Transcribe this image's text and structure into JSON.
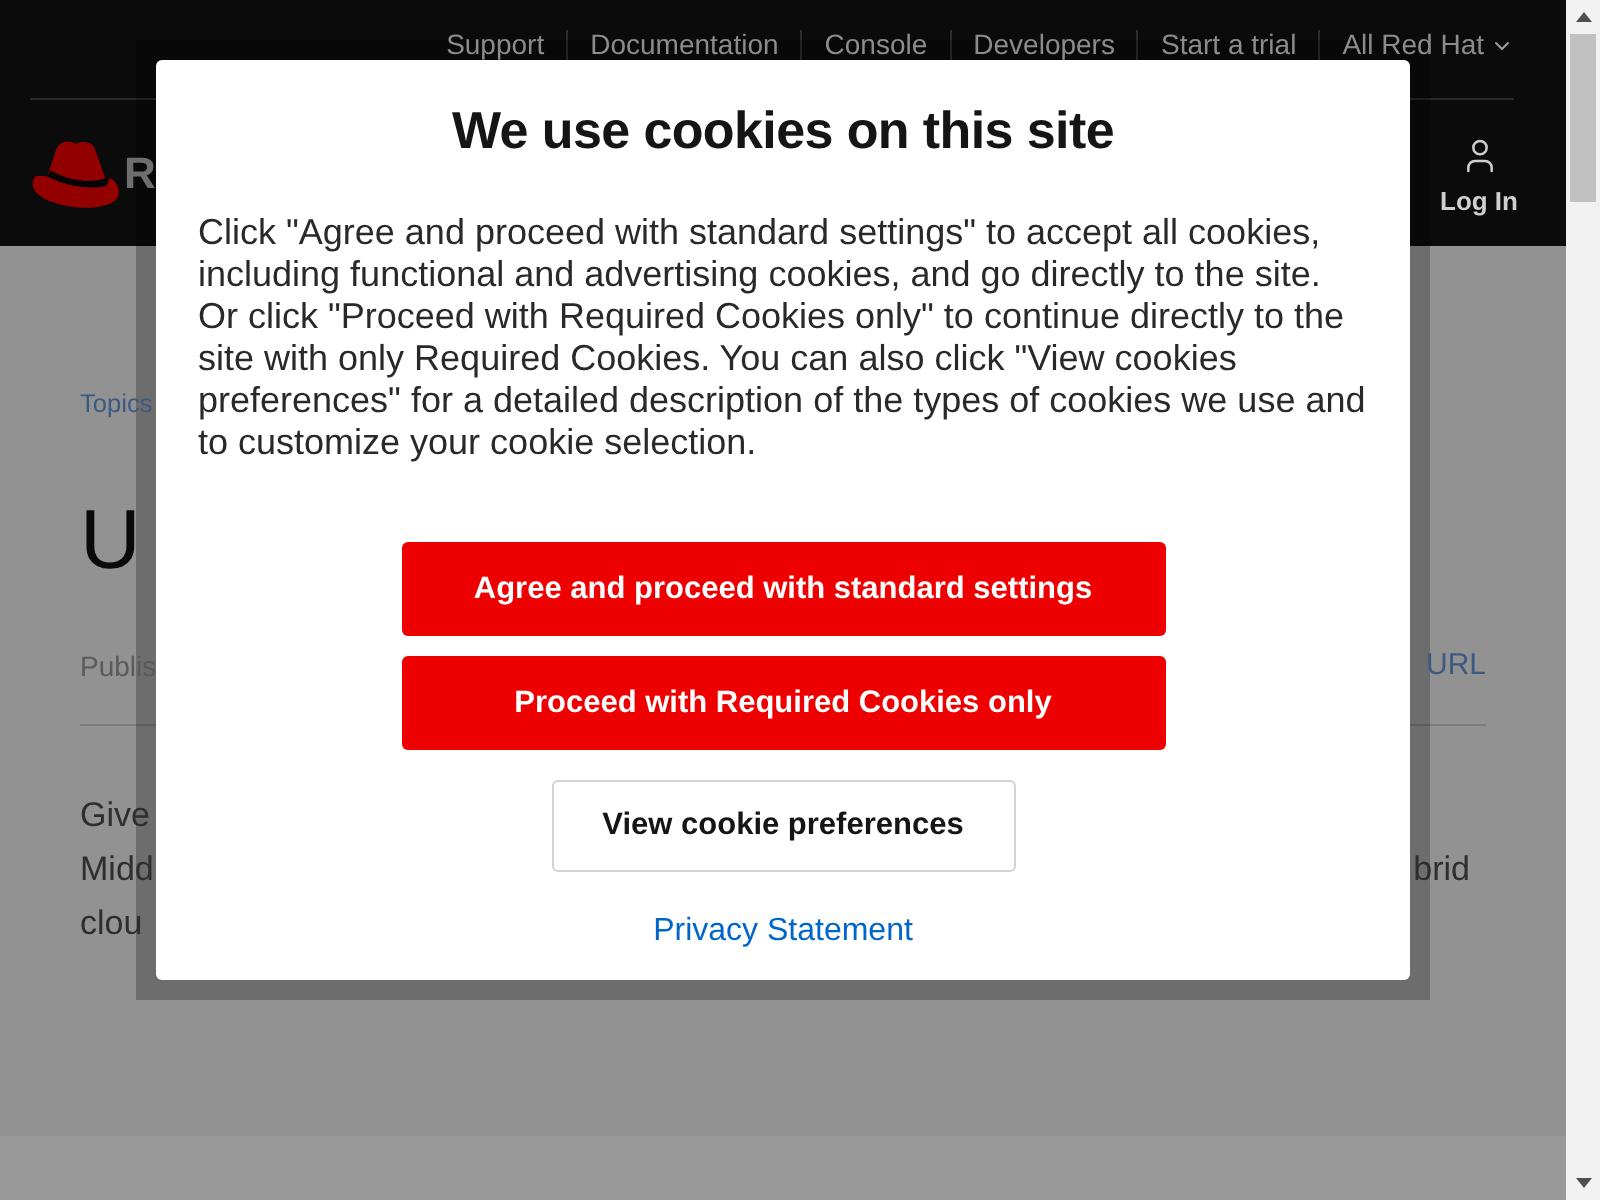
{
  "header": {
    "utility_nav": [
      {
        "label": "Support",
        "kind": "link"
      },
      {
        "label": "Documentation",
        "kind": "link"
      },
      {
        "label": "Console",
        "kind": "link"
      },
      {
        "label": "Developers",
        "kind": "link"
      },
      {
        "label": "Start a trial",
        "kind": "link"
      },
      {
        "label": "All Red Hat",
        "kind": "dropdown"
      }
    ],
    "logo_text": "R",
    "account": {
      "label": "Log In"
    }
  },
  "page": {
    "breadcrumb": "Topics",
    "heading": "U",
    "meta": "Publis",
    "meta_action": "URL",
    "paragraph_lines": [
      {
        "start": "Give"
      },
      {
        "start": "Midd",
        "end": "brid"
      },
      {
        "start": "clou"
      }
    ]
  },
  "cookie_dialog": {
    "title": "We use cookies on this site",
    "body": "Click \"Agree and proceed with standard settings\" to accept all cookies, including functional and advertising cookies, and go directly to the site. Or click \"Proceed with Required Cookies only\" to continue directly to the site with only Required Cookies. You can also click \"View cookies preferences\" for a detailed description of the types of cookies we use and to customize your cookie selection.",
    "buttons": [
      {
        "label": "Agree and proceed with standard settings",
        "kind": "primary"
      },
      {
        "label": "Proceed with Required Cookies only",
        "kind": "primary"
      },
      {
        "label": "View cookie preferences",
        "kind": "secondary"
      }
    ],
    "link": "Privacy Statement"
  }
}
